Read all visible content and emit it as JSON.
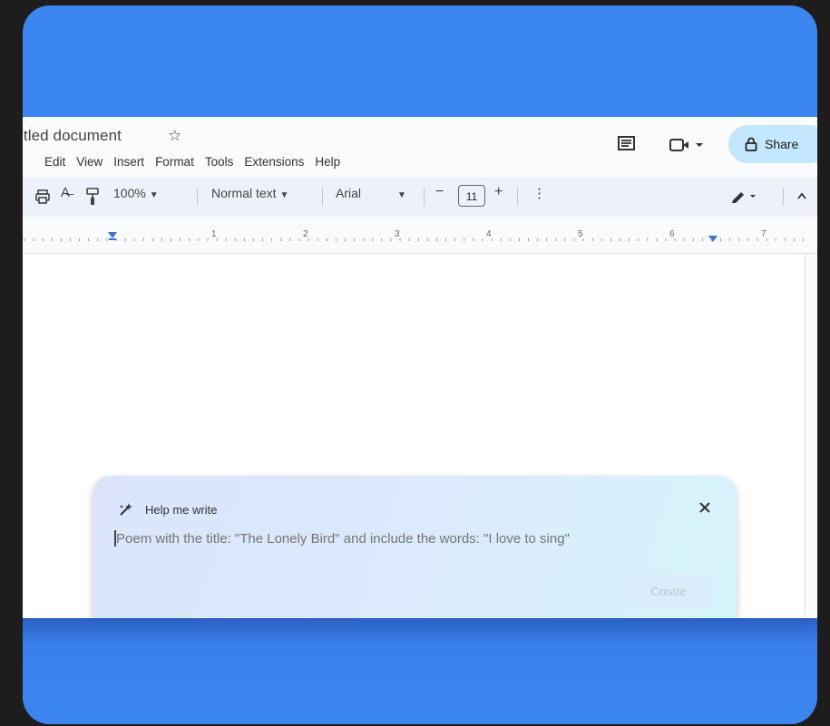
{
  "document": {
    "title": "itled document",
    "menu": [
      "Edit",
      "View",
      "Insert",
      "Format",
      "Tools",
      "Extensions",
      "Help"
    ],
    "share_label": "Share"
  },
  "toolbar": {
    "zoom": "100%",
    "style": "Normal text",
    "font": "Arial",
    "font_size": "11",
    "minus": "−",
    "plus": "+",
    "more": "⋮"
  },
  "ruler": {
    "numbers": [
      "1",
      "2",
      "3",
      "4",
      "5",
      "6",
      "7"
    ]
  },
  "help_me_write": {
    "title": "Help me write",
    "placeholder": "Poem with the title: \"The Lonely Bird\" and include the words: \"I love to sing\"",
    "create_label": "Create"
  },
  "colors": {
    "frame_blue": "#3b86f0",
    "share_bg": "#c2e7ff",
    "toolbar_bg": "#edf2fa",
    "ruler_marker": "#3c74d6"
  },
  "icons": [
    "star-icon",
    "comments-icon",
    "video-call-icon",
    "lock-icon",
    "print-icon",
    "spellcheck-icon",
    "paint-format-icon",
    "edit-mode-icon",
    "collapse-icon",
    "sparkle-pen-icon",
    "close-icon"
  ]
}
